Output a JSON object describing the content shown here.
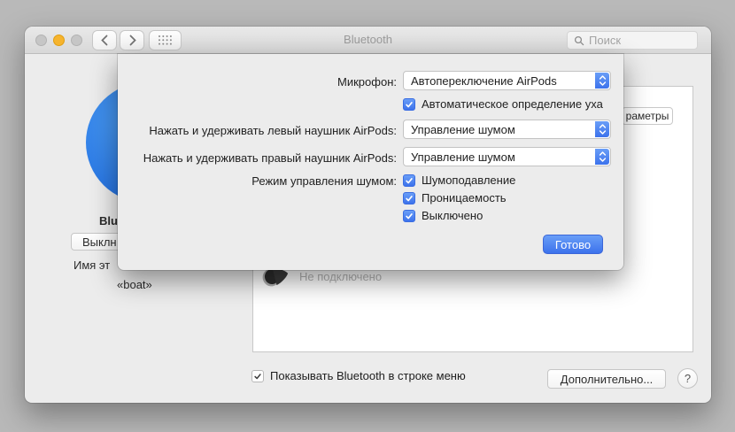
{
  "window": {
    "title": "Bluetooth"
  },
  "toolbar": {
    "search_placeholder": "Поиск"
  },
  "sidebar": {
    "bluetooth_label_fragment": "Blu",
    "toggle_button_fragment": "Выклн",
    "computer_name_fragment": "Имя эт",
    "device_name": "«boat»"
  },
  "sheet": {
    "microphone_label": "Микрофон:",
    "microphone_value": "Автопереключение AirPods",
    "ear_detection_label": "Автоматическое определение уха",
    "left_hold_label": "Нажать и удерживать левый наушник AirPods:",
    "left_hold_value": "Управление шумом",
    "right_hold_label": "Нажать и удерживать правый наушник AirPods:",
    "right_hold_value": "Управление шумом",
    "noise_mode_label": "Режим управления шумом:",
    "noise_options": [
      "Шумоподавление",
      "Проницаемость",
      "Выключено"
    ],
    "done_label": "Готово"
  },
  "device_list": {
    "options_button_fragment": "раметры",
    "status_text": "Не подключено"
  },
  "footer": {
    "show_in_menubar_label": "Показывать Bluetooth в строке меню",
    "advanced_label": "Дополнительно...",
    "help_label": "?"
  },
  "colors": {
    "accent_blue": "#3c72ec",
    "accent_blue_light": "#699ef7",
    "bluetooth_blue": "#2572e2"
  }
}
